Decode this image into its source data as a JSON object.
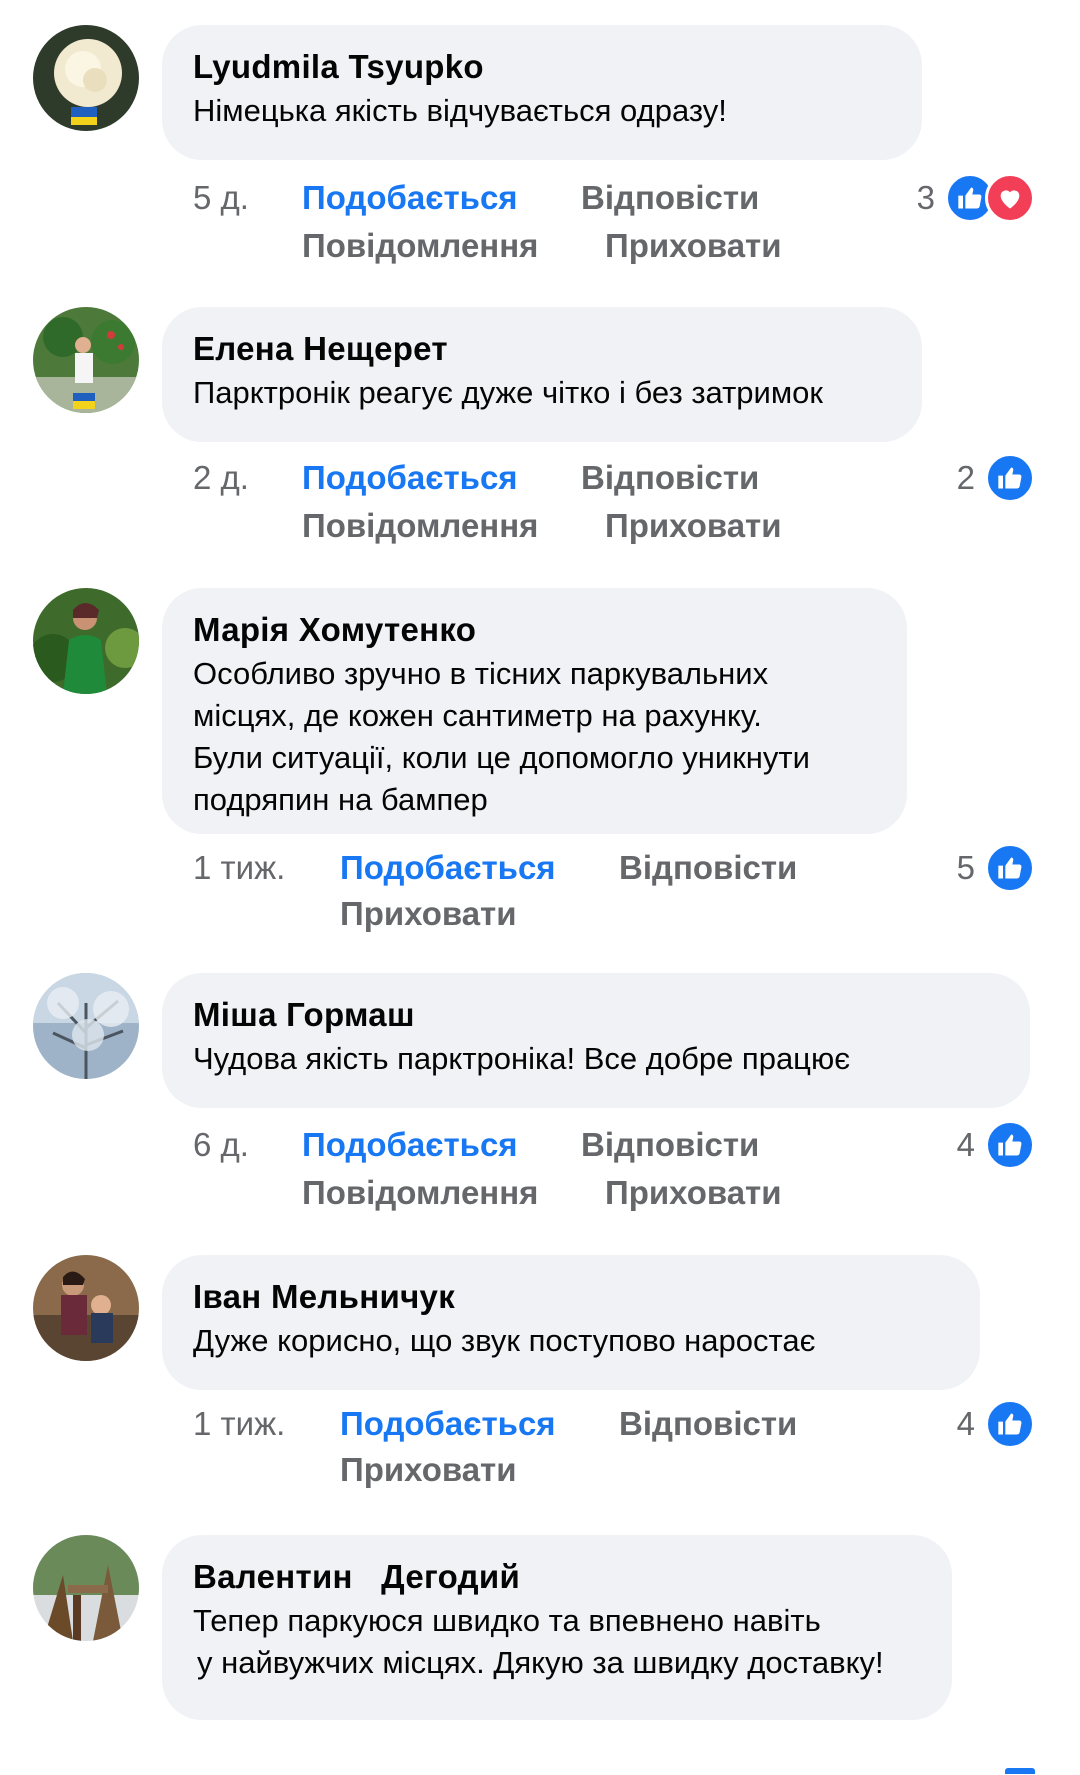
{
  "comments": [
    {
      "author": "Lyudmila  Tsyupko",
      "text": "Німецька якість відчувається одразу!",
      "time": "5 д.",
      "like": "Подобається",
      "reply": "Відповісти",
      "message": "Повідомлення",
      "hide": "Приховати",
      "reaction_count": "3",
      "reactions": [
        "like-icon",
        "love-icon"
      ]
    },
    {
      "author": "Елена Нещерет",
      "text": "Парктронік реагує дуже чітко і без затримок",
      "time": "2 д.",
      "like": "Подобається",
      "reply": "Відповісти",
      "message": "Повідомлення",
      "hide": "Приховати",
      "reaction_count": "2",
      "reactions": [
        "like-icon"
      ]
    },
    {
      "author": "Марія Хомутенко",
      "text_lines": [
        "Особливо зручно в тісних паркувальних",
        "місцях, де кожен сантиметр на рахунку.",
        "Були ситуації, коли це допомогло уникнути",
        "подряпин на бампер"
      ],
      "time": "1 тиж.",
      "like": "Подобається",
      "reply": "Відповісти",
      "hide": "Приховати",
      "reaction_count": "5",
      "reactions": [
        "like-icon"
      ]
    },
    {
      "author": "Міша Гормаш",
      "text": "Чудова якість парктроніка! Все добре працює",
      "time": "6 д.",
      "like": "Подобається",
      "reply": "Відповісти",
      "message": "Повідомлення",
      "hide": "Приховати",
      "reaction_count": "4",
      "reactions": [
        "like-icon"
      ]
    },
    {
      "author": "Іван Мельничук",
      "text": "Дуже корисно, що звук поступово наростає",
      "time": "1 тиж.",
      "like": "Подобається",
      "reply": "Відповісти",
      "hide": "Приховати",
      "reaction_count": "4",
      "reactions": [
        "like-icon"
      ]
    },
    {
      "author": "Валентин   Дегодий",
      "text_lines": [
        "Тепер паркуюся швидко та впевнено навіть",
        "у найвужчих місцях. Дякую за швидку доставку!"
      ]
    }
  ],
  "colors": {
    "accent": "#1877f2",
    "love": "#f33e58",
    "bubble": "#f0f2f5",
    "secondary_text": "#65676b"
  }
}
